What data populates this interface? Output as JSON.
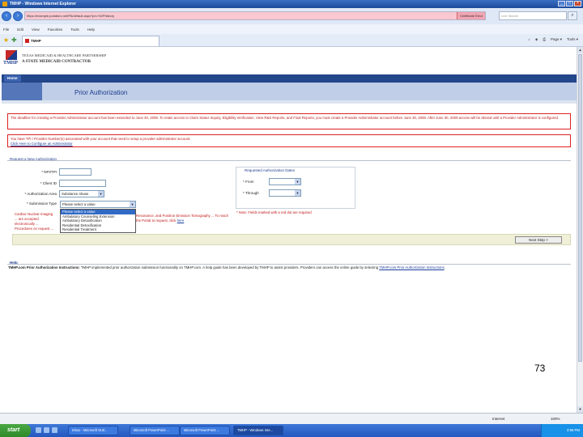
{
  "window": {
    "title": "TMHP - Windows Internet Explorer"
  },
  "browser": {
    "url": "https://example.portalsrc.net/PA/default.aspx?pn=%2Fhistory",
    "cert_error": "Certificate Error",
    "search_placeholder": "Live Search",
    "menu": [
      "File",
      "Edit",
      "View",
      "Favorites",
      "Tools",
      "Help"
    ],
    "tab_title": "TMHP",
    "commands": [
      "Page ▾",
      "Tools ▾"
    ]
  },
  "site": {
    "logo_text": "TMHP",
    "org_line1": "TEXAS MEDICAID & HEALTHCARE PARTNERSHIP",
    "org_line2": "A STATE MEDICAID CONTRACTOR",
    "home_label": "Home",
    "page_heading": "Prior Authorization"
  },
  "alerts": {
    "deadline": "The deadline for creating a Provider Administrator account has been extended to June 30, 2009. To retain access to Claim Status Inquiry, Eligibility Verification, View R&S Reports, and Final Reports, you must create a Provider Administrator account before June 30, 2009. After June 30, 2009 access will be denied until a Provider Administrator is configured.",
    "tpi_notice": "You have TPI / Provider Number(s) associated with your account that need to setup a provider administrator account.",
    "tpi_link": "Click Here to Configure an Administrator"
  },
  "form": {
    "section_title": "Request a New Authorization",
    "npi_label": "* NPI/TPI",
    "client_label": "* Client ID",
    "area_label": "* Authorization Area",
    "area_value": "Substance Abuse",
    "submission_label": "* Submission Type",
    "submission_value": "Please select a value",
    "submission_options": [
      "Please select a value",
      "Ambulatory Counseling Extension",
      "Ambulatory Detoxification",
      "Residential Detoxification",
      "Residential Treatment"
    ],
    "submission_highlight": 0,
    "dates_title": "Requested Authorization Dates",
    "from_label": "* From",
    "through_label": "* Through",
    "required_note": "* Note: Fields marked with a red dot are required",
    "red_note_left": "Cardiac Nuclear Imaging ... are accepted electronically ... Procedures on request ...",
    "red_note_right": "Resonance, and Positron Emission Tomography ... To reach the Portal to request, click",
    "red_note_link": "here",
    "next_button": "Next Step >"
  },
  "help": {
    "title": "Help",
    "bold_lead": "TMHP.com Prior Authorization Instructions:",
    "text": " TMHP implemented prior authorization submission functionality on TMHP.com. A help guide has been developed by TMHP to assist providers. Providers can access the online guide by selecting ",
    "link": "TMHP.com Prior Authorization Instructions",
    "tail": "."
  },
  "slide_number": "73",
  "statusbar": {
    "zone": "Internet",
    "zoom": "100%"
  },
  "taskbar": {
    "start": "start",
    "tasks": [
      "Inbox - Microsoft Outl...",
      "Microsoft PowerPoint ...",
      "Microsoft PowerPoint ...",
      "TMHP - Windows Inte..."
    ],
    "clock": "3:58 PM"
  }
}
